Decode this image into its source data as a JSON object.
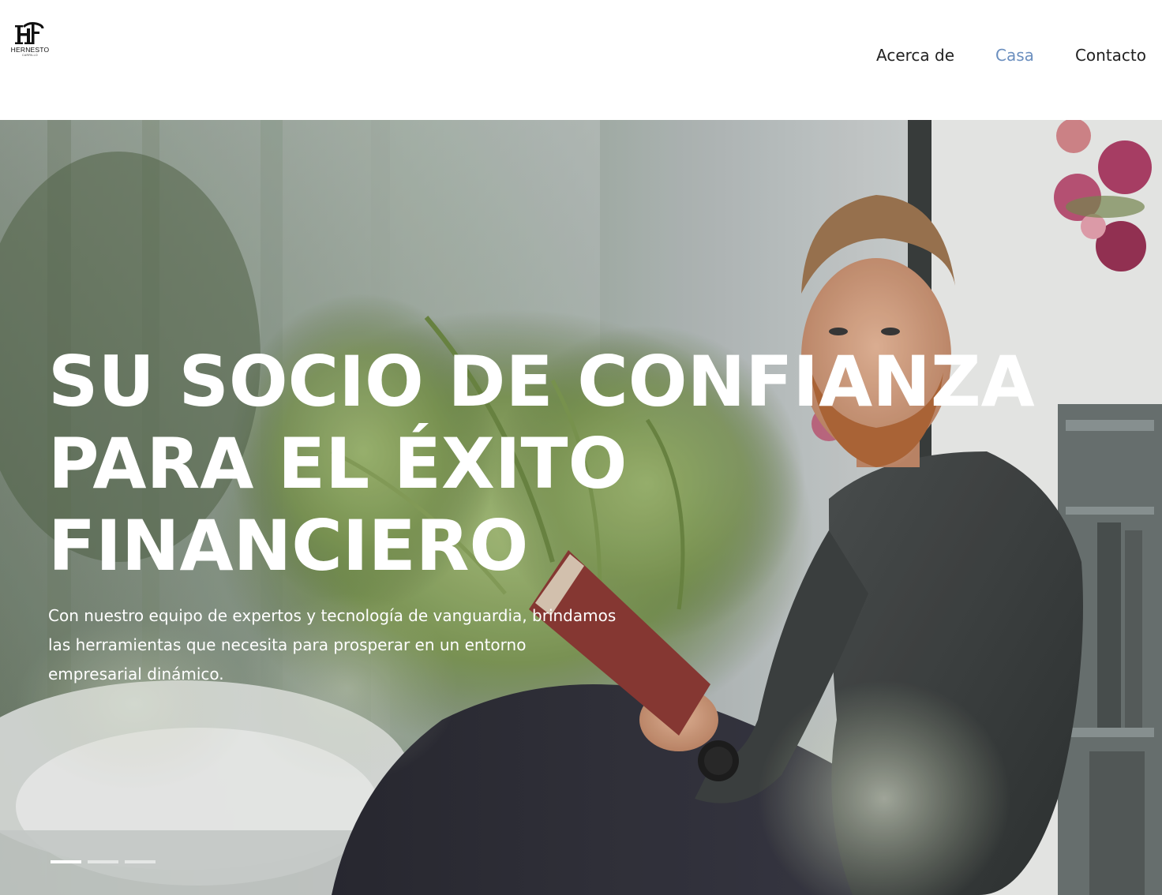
{
  "brand": {
    "logo_mark": "HC",
    "name": "HERNESTO",
    "sub": "CARRILLO"
  },
  "nav": {
    "items": [
      {
        "label": "Acerca de",
        "active": false
      },
      {
        "label": "Casa",
        "active": true
      },
      {
        "label": "Contacto",
        "active": false
      }
    ]
  },
  "hero": {
    "title_lines": [
      "SU SOCIO DE CONFIANZA",
      "PARA EL ÉXITO",
      "FINANCIERO"
    ],
    "subtitle": "Con nuestro equipo de expertos y tecnología de vanguardia, brindamos las herramientas que necesita para prosperar en un entorno empresarial dinámico.",
    "slides_total": 3,
    "slide_active": 1
  },
  "colors": {
    "nav_active": "#6b8fbf",
    "nav_text": "#222222",
    "hero_text": "#ffffff"
  }
}
